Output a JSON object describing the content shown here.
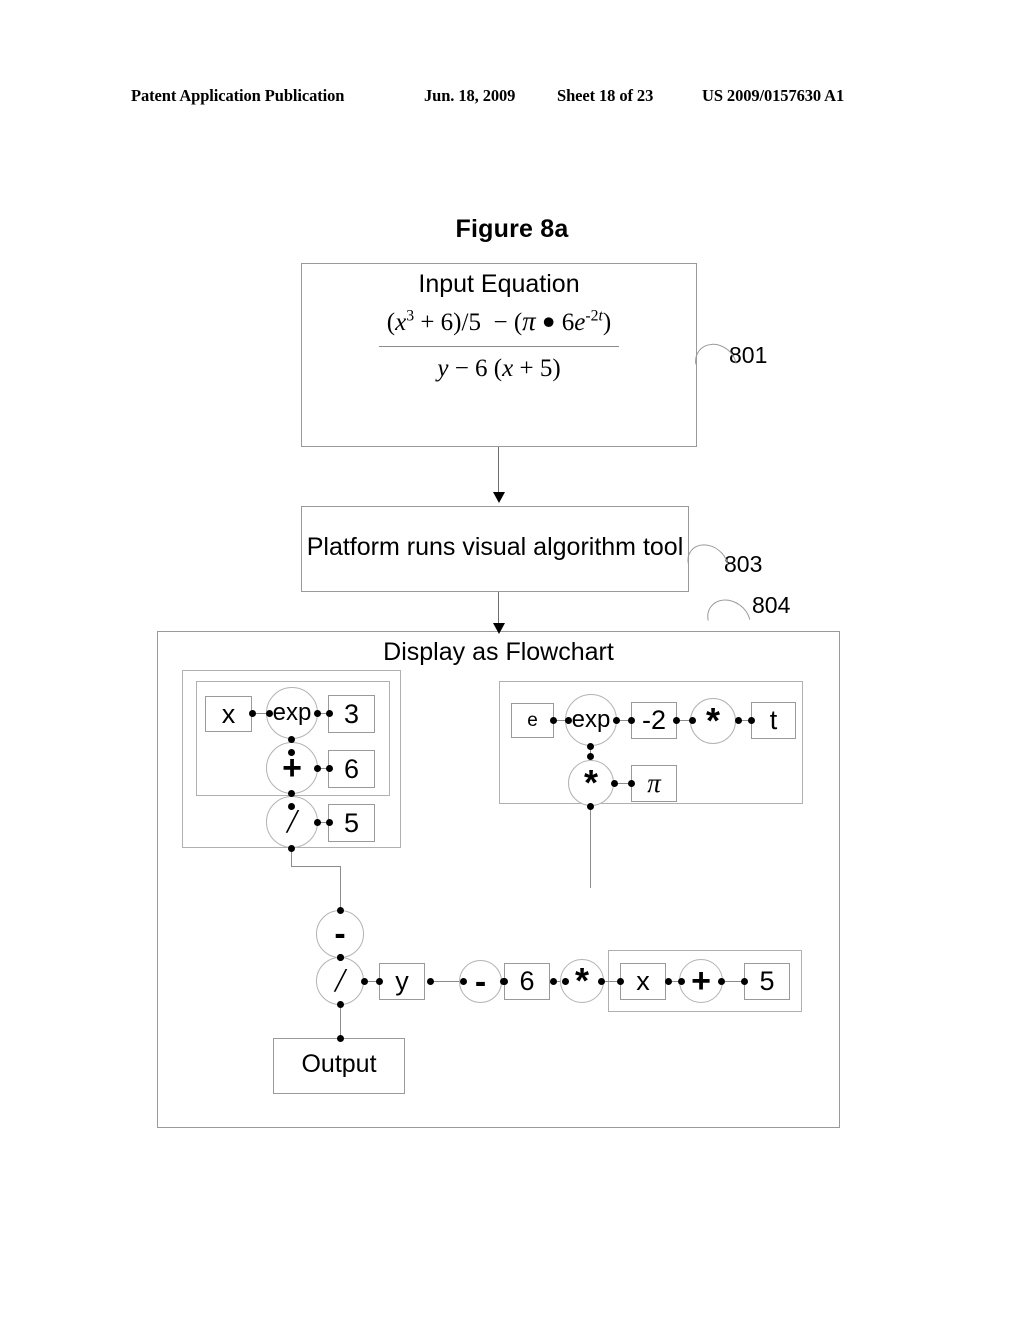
{
  "header": {
    "publication": "Patent Application Publication",
    "date": "Jun. 18, 2009",
    "sheet": "Sheet 18 of 23",
    "patent_number": "US 2009/0157630 A1"
  },
  "figure": {
    "title": "Figure 8a"
  },
  "stages": {
    "input": {
      "label": "Input Equation",
      "ref": "801",
      "equation": {
        "numerator": "(x3 + 6)/5  − (π ● 6e-2t)",
        "denominator": "y − 6 (x + 5)",
        "numerator_parts": {
          "open": "(",
          "base_x": "x",
          "exp_3": "3",
          "plus_six": " + 6)/5",
          "minus": "−",
          "open2": "(",
          "pi": "π",
          "bullet": "●",
          "six_e": "6e",
          "exp_m2t": "-2t",
          "close2": ")"
        },
        "denominator_parts": {
          "y": "y",
          "minus_six": "− 6 (",
          "x": "x",
          "plus_five": " + 5)"
        }
      }
    },
    "process": {
      "label": "Platform runs visual algorithm tool",
      "ref": "803"
    },
    "display": {
      "label": "Display as Flowchart",
      "ref": "804",
      "output_label": "Output"
    }
  },
  "flowchart": {
    "group_left": {
      "nodes": {
        "x": "x",
        "exp": "exp",
        "three": "3",
        "plus": "+",
        "six": "6",
        "divide": "/",
        "five": "5"
      }
    },
    "group_right": {
      "nodes": {
        "e": "e",
        "exp": "exp",
        "minus_two": "-2",
        "times": "*",
        "t": "t",
        "times2": "*",
        "pi": "π"
      }
    },
    "bottom_chain": {
      "nodes": {
        "minus": "-",
        "divide": "/",
        "y": "y",
        "minus2": "-",
        "six": "6",
        "times": "*",
        "x": "x",
        "plus": "+",
        "five": "5"
      }
    }
  },
  "colors": {
    "ink": "#000000",
    "line": "#9a9a9a",
    "wire": "#8c8c8c",
    "background": "#ffffff"
  }
}
